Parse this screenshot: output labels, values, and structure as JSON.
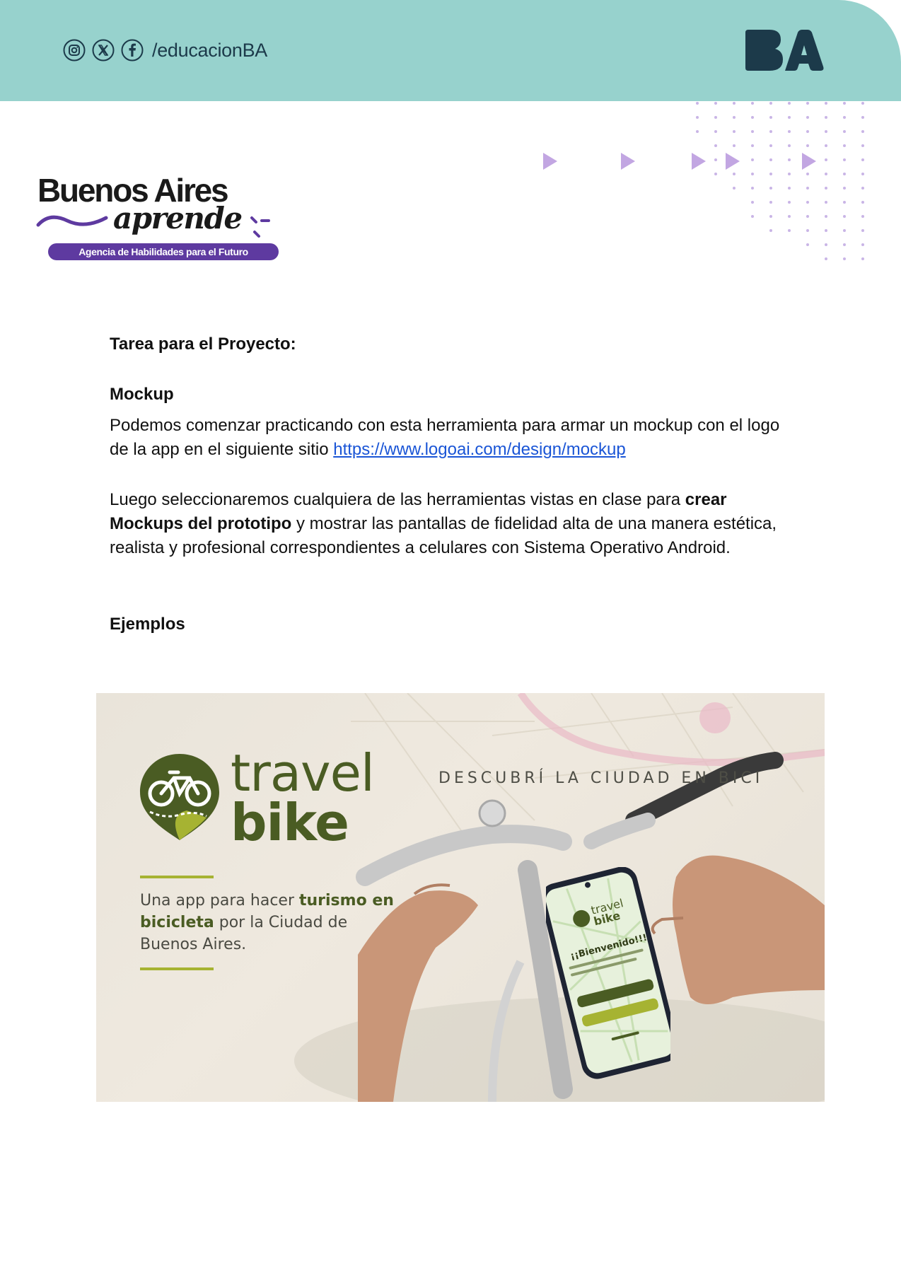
{
  "header": {
    "social_handle": "/educacionBA",
    "social_icons": [
      "instagram-icon",
      "x-icon",
      "facebook-icon"
    ],
    "brand_logo": "BA",
    "band_color": "#97d2cd",
    "logo_color": "#1c3a4a"
  },
  "agency": {
    "title": "Buenos Aires",
    "script": "aprende",
    "subtitle": "Agencia de Habilidades para el Futuro",
    "accent_color": "#5e3aa0"
  },
  "doc": {
    "task_heading": "Tarea para el Proyecto:",
    "mockup_heading": "Mockup",
    "p1_text": "Podemos comenzar practicando con esta herramienta para armar un mockup con el logo de la app en el siguiente sitio ",
    "p1_link": "https://www.logoai.com/design/mockup",
    "p2_a": "Luego seleccionaremos cualquiera de las herramientas vistas en clase para ",
    "p2_bold": "crear Mockups del prototipo",
    "p2_b": " y mostrar las pantallas de fidelidad alta de una manera estética, realista y profesional correspondientes a celulares con Sistema Operativo Android.",
    "examples_heading": "Ejemplos",
    "link_color": "#1a55d6"
  },
  "example": {
    "brand_line1": "travel",
    "brand_line2": "bike",
    "tagline": "DESCUBRÍ LA CIUDAD EN BICI",
    "blurb_1": "Una app para hacer ",
    "blurb_bold1": "turismo en bicicleta",
    "blurb_2": " por la Ciudad de Buenos Aires.",
    "phone_welcome": "¡¡Bienvenido!!!",
    "brand_color": "#4a5c23",
    "accent_color": "#a6b332"
  }
}
